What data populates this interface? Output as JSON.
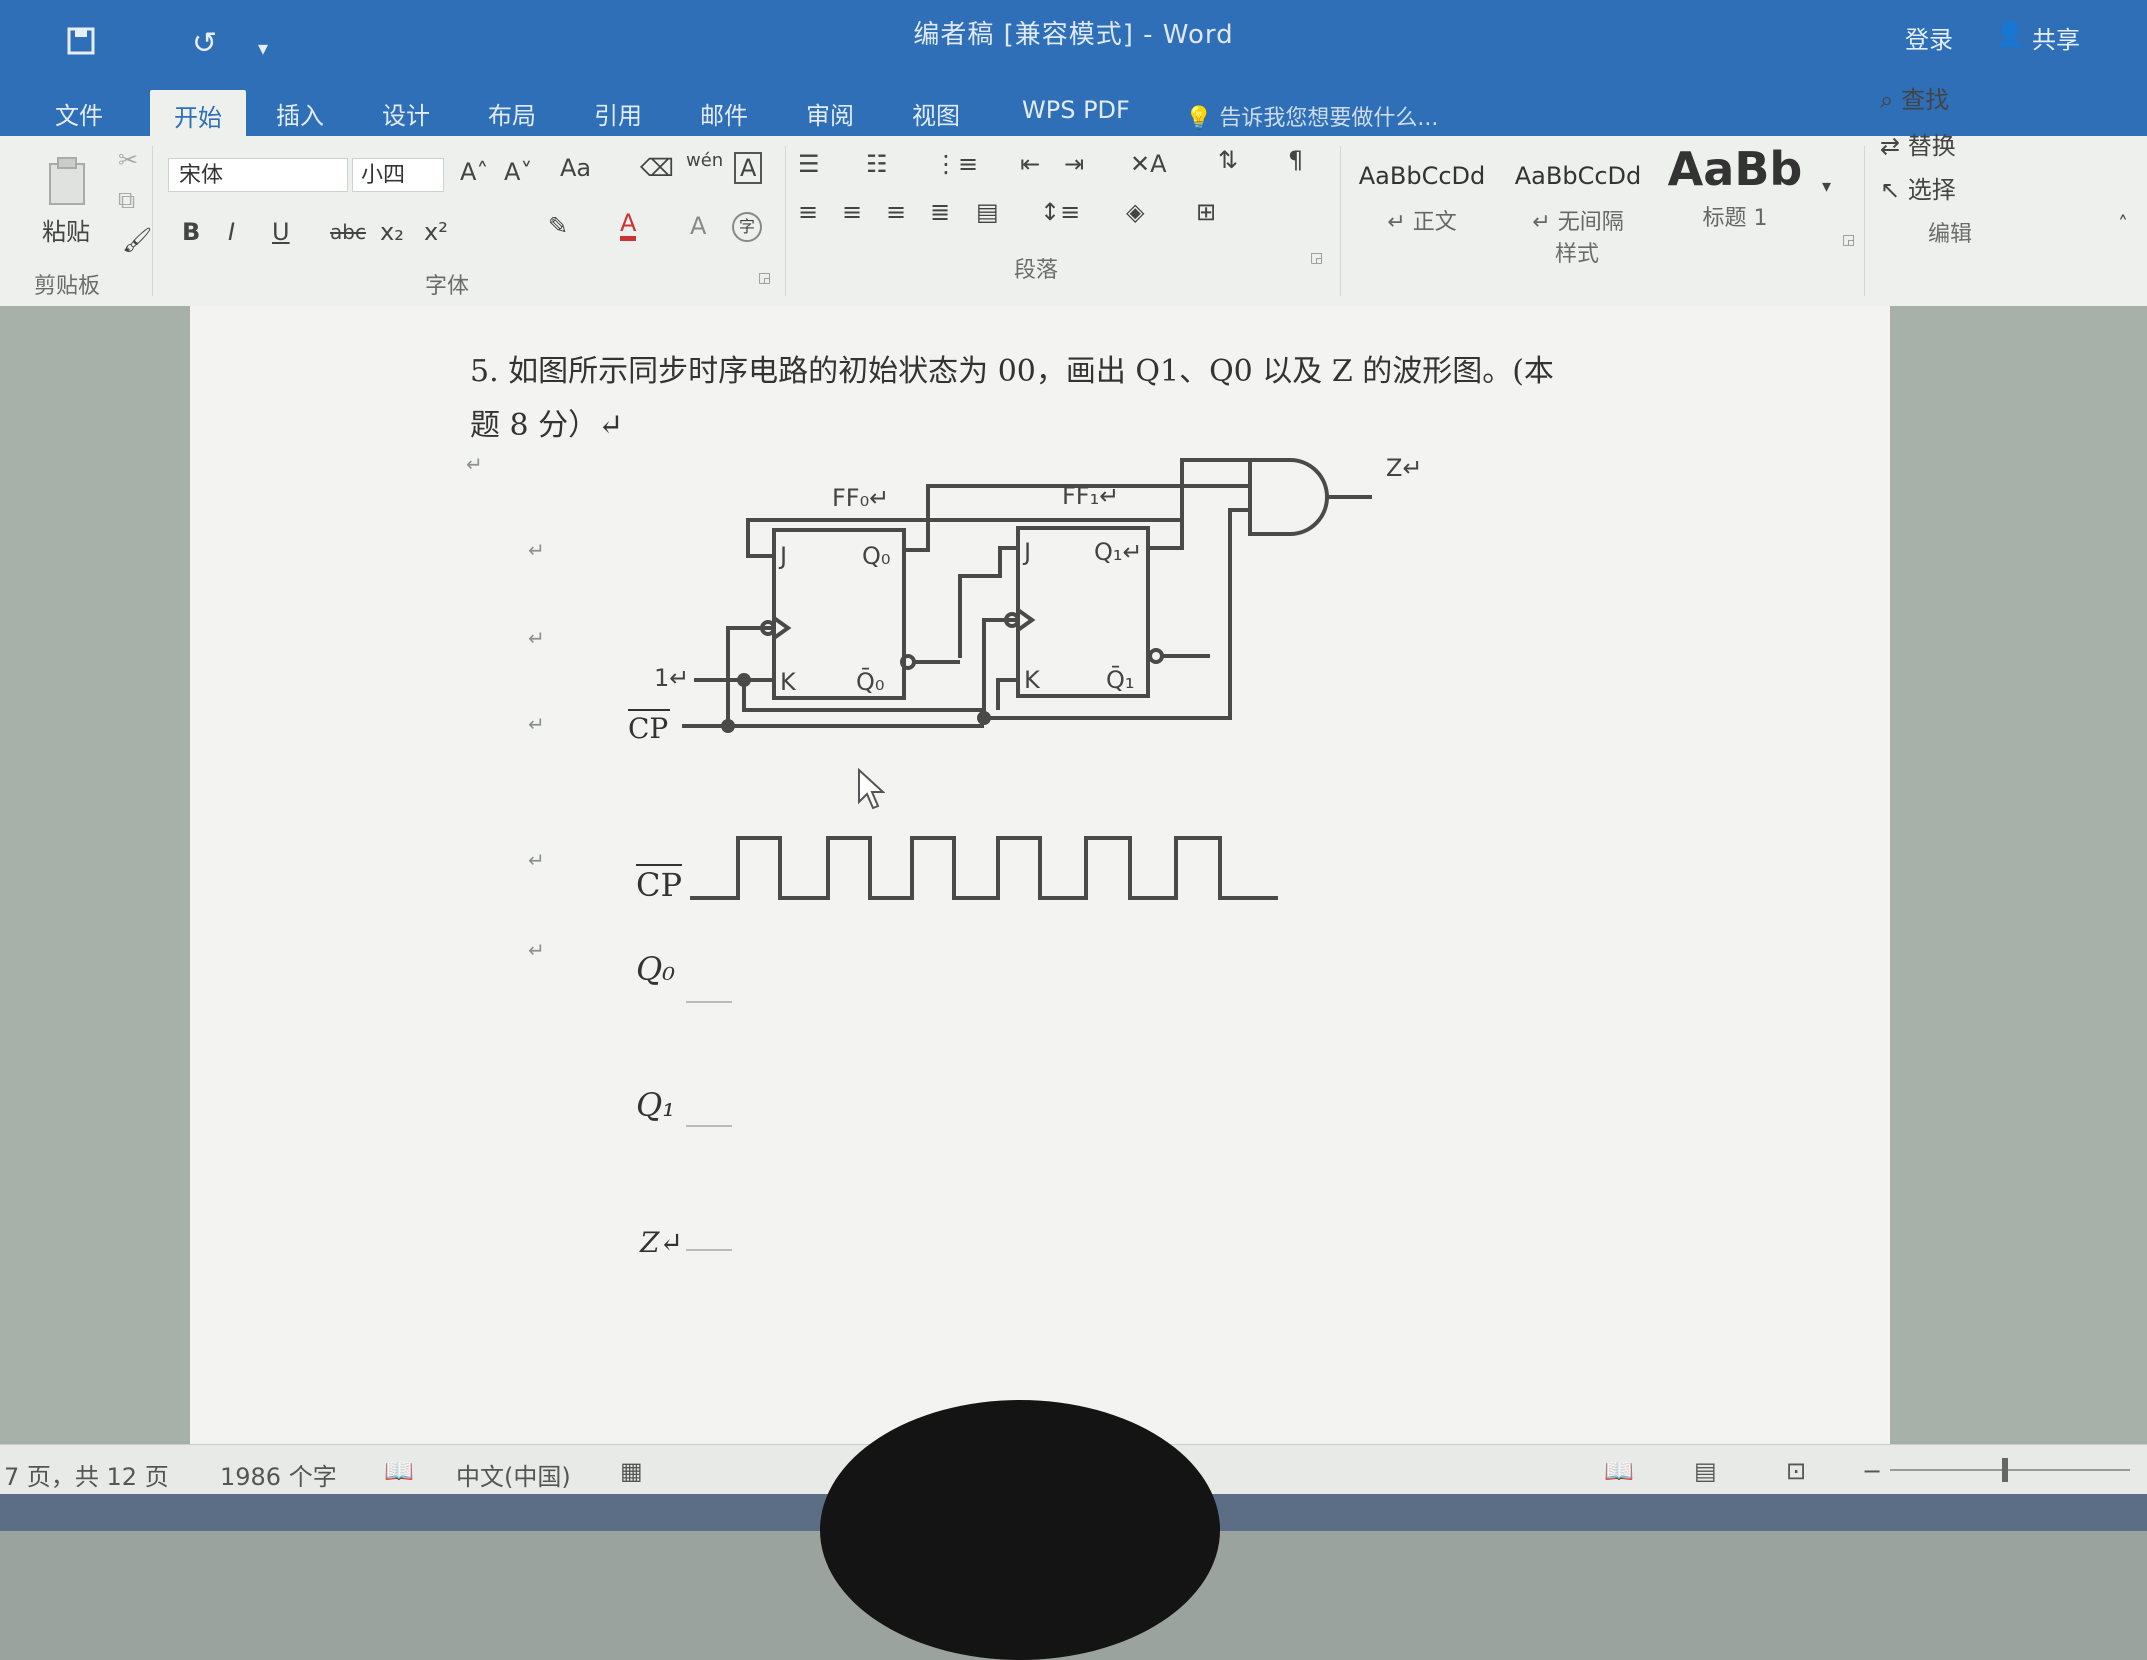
{
  "window": {
    "title": "编者稿 [兼容模式] - Word",
    "login": "登录",
    "share": "共享"
  },
  "quick_access": {
    "save_icon": "save-icon",
    "undo_icon": "undo-icon",
    "customize": "▾"
  },
  "tabs": [
    {
      "label": "文件"
    },
    {
      "label": "开始"
    },
    {
      "label": "插入"
    },
    {
      "label": "设计"
    },
    {
      "label": "布局"
    },
    {
      "label": "引用"
    },
    {
      "label": "邮件"
    },
    {
      "label": "审阅"
    },
    {
      "label": "视图"
    },
    {
      "label": "WPS PDF"
    }
  ],
  "tell_me": "告诉我您想要做什么...",
  "ribbon": {
    "paste_label": "粘贴",
    "clipboard_label": "剪贴板",
    "font_name": "宋体",
    "font_size": "小四",
    "font_grow": "A˄",
    "font_shrink": "A˅",
    "change_case": "Aa",
    "bold": "B",
    "italic": "I",
    "underline": "U",
    "strike": "abc",
    "subscript": "x₂",
    "superscript": "x²",
    "font_color_a": "A",
    "font_group_label": "字体",
    "paragraph_group_label": "段落",
    "styles": [
      {
        "sample": "AaBbCcDd",
        "name": "↵ 正文"
      },
      {
        "sample": "AaBbCcDd",
        "name": "↵ 无间隔"
      },
      {
        "sample": "AaBb",
        "name": "标题 1"
      }
    ],
    "styles_group_label": "样式",
    "find": "查找",
    "replace": "替换",
    "select": "选择",
    "editing_group_label": "编辑"
  },
  "document": {
    "question_line1": "5. 如图所示同步时序电路的初始状态为 00，画出 Q1、Q0 以及 Z 的波形图。(本",
    "question_line2": "题 8 分）↵",
    "para_mark": "↵",
    "circuit": {
      "ff0_label": "FF₀↵",
      "ff1_label": "FF₁↵",
      "j0": "J",
      "k0": "K",
      "q0": "Q₀",
      "q0_bar": "Q̄₀",
      "j1": "J",
      "k1": "K",
      "q1": "Q₁↵",
      "q1_bar": "Q̄₁",
      "one_label": "1↵",
      "cp_label": "CP",
      "z_label": "Z↵"
    },
    "waveform": {
      "cp_label": "CP",
      "q0_label": "Q₀",
      "q1_label": "Q₁",
      "z_label": "Z↵"
    }
  },
  "status": {
    "page": "7 页，共 12 页",
    "words": "1986 个字",
    "language": "中文(中国)"
  }
}
